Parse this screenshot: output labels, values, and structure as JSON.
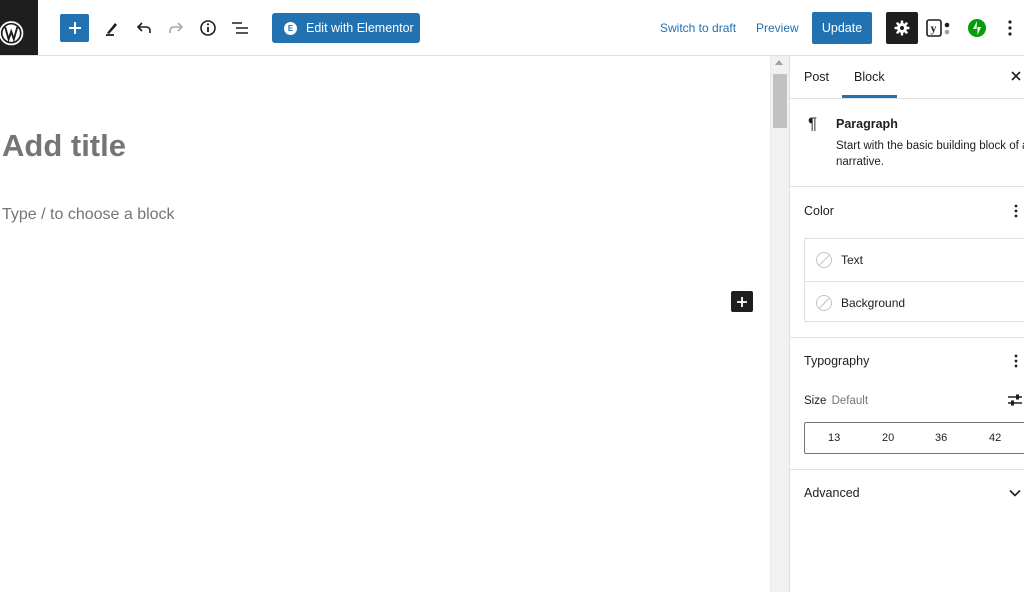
{
  "toolbar": {
    "elementor_label": "Edit with Elementor",
    "switch_to_draft_label": "Switch to draft",
    "preview_label": "Preview",
    "update_label": "Update",
    "icons": [
      "wordpress-logo-icon",
      "plus-icon",
      "pencil-icon",
      "undo-icon",
      "redo-icon",
      "info-icon",
      "list-view-icon",
      "gear-icon",
      "yoast-icon",
      "jetpack-icon",
      "more-vertical-icon"
    ]
  },
  "editor": {
    "title_placeholder": "Add title",
    "block_placeholder": "Type / to choose a block"
  },
  "sidebar": {
    "tabs": [
      {
        "label": "Post",
        "active": false
      },
      {
        "label": "Block",
        "active": true
      }
    ],
    "block_card": {
      "title": "Paragraph",
      "description": "Start with the basic building block of all narrative."
    },
    "color_panel": {
      "title": "Color",
      "items": [
        {
          "label": "Text"
        },
        {
          "label": "Background"
        }
      ]
    },
    "typography_panel": {
      "title": "Typography",
      "size_label": "Size",
      "size_value": "Default",
      "size_options": [
        "13",
        "20",
        "36",
        "42"
      ]
    },
    "advanced_panel": {
      "title": "Advanced"
    }
  },
  "colors": {
    "accent": "#2271b1",
    "dark": "#1e1e1e",
    "jetpack_green": "#069e08",
    "muted_text": "#757575"
  }
}
